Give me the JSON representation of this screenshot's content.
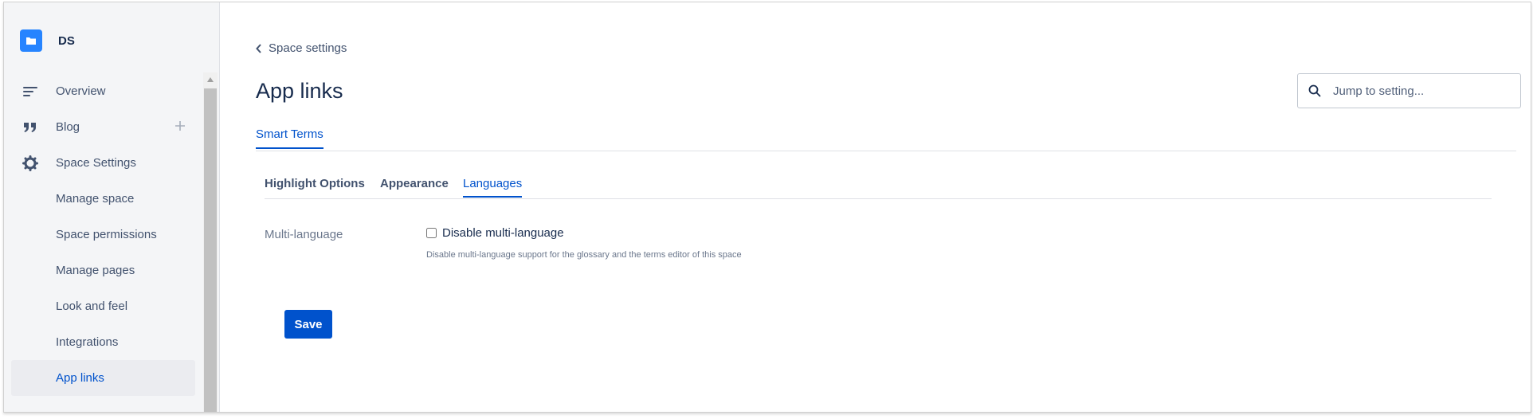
{
  "space": {
    "name": "DS",
    "logo_icon": "space-folder-icon",
    "logo_color": "#2684ff"
  },
  "sidebar": {
    "items": [
      {
        "label": "Overview",
        "icon": "overview-icon"
      },
      {
        "label": "Blog",
        "icon": "quote-icon",
        "action_icon": "plus-icon"
      },
      {
        "label": "Space Settings",
        "icon": "gear-icon"
      },
      {
        "label": "Manage space"
      },
      {
        "label": "Space permissions"
      },
      {
        "label": "Manage pages"
      },
      {
        "label": "Look and feel"
      },
      {
        "label": "Integrations"
      },
      {
        "label": "App links",
        "selected": true
      }
    ]
  },
  "breadcrumb": {
    "label": "Space settings",
    "icon": "chevron-left-icon"
  },
  "page": {
    "title": "App links"
  },
  "search": {
    "placeholder": "Jump to setting...",
    "value": "",
    "icon": "search-icon"
  },
  "top_tabs": [
    {
      "label": "Smart Terms",
      "active": true
    }
  ],
  "sub_tabs": [
    {
      "label": "Highlight Options",
      "active": false
    },
    {
      "label": "Appearance",
      "active": false
    },
    {
      "label": "Languages",
      "active": true
    }
  ],
  "form": {
    "multi_language": {
      "label": "Multi-language",
      "checkbox_label": "Disable multi-language",
      "checked": false,
      "help": "Disable multi-language support for the glossary and the terms editor of this space"
    },
    "save_label": "Save"
  },
  "colors": {
    "accent": "#0052cc",
    "sidebar_bg": "#f4f5f7",
    "text": "#172b4d"
  }
}
